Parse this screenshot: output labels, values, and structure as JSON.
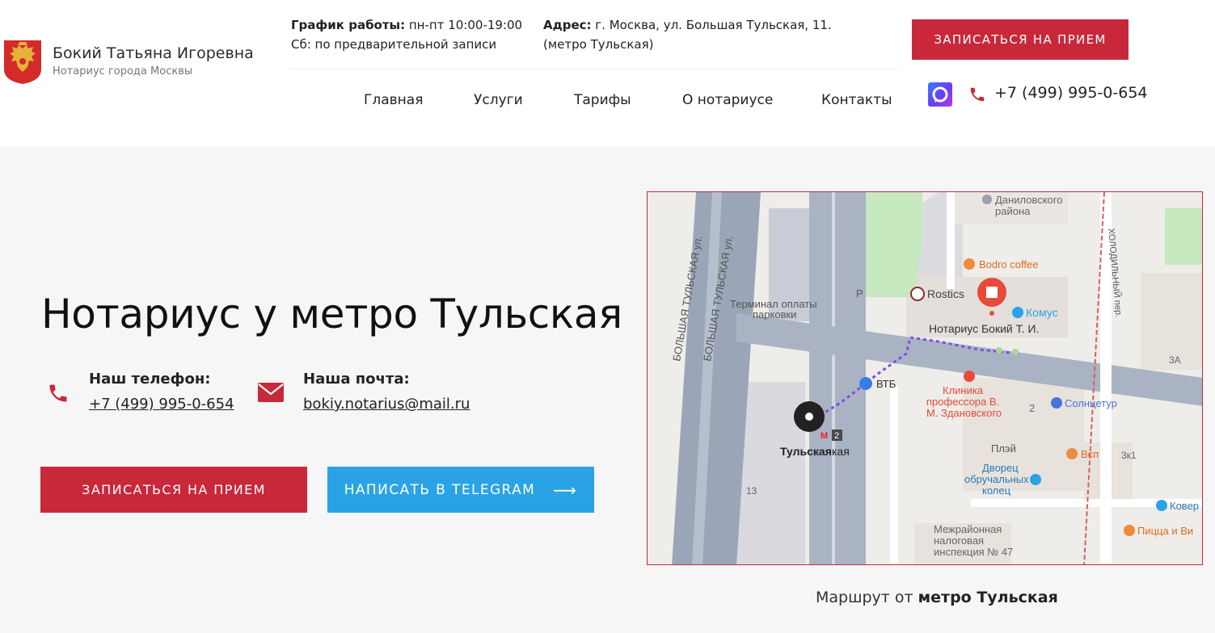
{
  "header": {
    "brand_name": "Бокий Татьяна Игоревна",
    "brand_sub": "Нотариус города Москвы",
    "hours_label": "График работы:",
    "hours_value": " пн-пт 10:00-19:00",
    "hours_sat": "Сб: по предварительной записи",
    "address_label": "Адрес:",
    "address_value": " г. Москва, ул. Большая Тульская, 11.",
    "address_metro": "(метро Тульская)",
    "cta": "ЗАПИСАТЬСЯ НА ПРИЕМ",
    "phone": "+7 (499) 995-0-654"
  },
  "nav": {
    "items": [
      {
        "label": "Главная"
      },
      {
        "label": "Услуги"
      },
      {
        "label": "Тарифы"
      },
      {
        "label": "О нотариусе"
      },
      {
        "label": "Контакты"
      }
    ]
  },
  "hero": {
    "title": "Нотариус у метро Тульская",
    "phone_label": "Наш телефон:",
    "phone_value": "+7 (499) 995-0-654",
    "email_label": "Наша почта:",
    "email_value": "bokiy.notarius@mail.ru",
    "btn_appointment": "ЗАПИСАТЬСЯ НА ПРИЕМ",
    "btn_telegram": "НАПИСАТЬ В TELEGRAM",
    "btn_telegram_arrow": "⟶"
  },
  "map": {
    "street_1": "БОЛЬШАЯ ТУЛЬСКАЯ ул.",
    "street_2": "БОЛЬШАЯ ТУЛЬСКАЯ ул.",
    "street_3": "ХОЛОДИЛЬНЫЙ пер.",
    "poi_danilov_1": "Даниловского",
    "poi_danilov_2": "района",
    "poi_bodro": "Bodro coffee",
    "poi_rostics": "Rostics",
    "poi_komus": "Комус",
    "poi_notary": "Нотариус Бокий Т. И.",
    "poi_terminal_1": "Терминал оплаты",
    "poi_terminal_2": "парковки",
    "poi_vtb": "ВТБ",
    "poi_clinic_1": "Клиника",
    "poi_clinic_2": "профессора В.",
    "poi_clinic_3": "М. Здановского",
    "poi_solnce": "Солнцетур",
    "poi_metro": "Тульская",
    "poi_metro_suffix": "кая",
    "poi_metro_badge": "2",
    "poi_pley": "Плэй",
    "poi_vsp": "Всп",
    "poi_dvorec_1": "Дворец",
    "poi_dvorec_2": "обручальных",
    "poi_dvorec_3": "колец",
    "poi_kover": "Ковер",
    "poi_pizza": "Пицца и Ви",
    "poi_tax_1": "Межрайонная",
    "poi_tax_2": "налоговая",
    "poi_tax_3": "инспекция № 47",
    "num_13": "13",
    "num_2": "2",
    "num_3k1": "3к1",
    "num_3a": "3А",
    "letter_r": "Р",
    "caption_prefix": "Маршрут от ",
    "caption_bold": "метро Тульская"
  },
  "colors": {
    "brand_red": "#c8283a",
    "telegram_blue": "#2aa3e6",
    "hero_bg": "#f6f6f6"
  },
  "icons": {
    "logo": "coat-of-arms-icon",
    "max": "max-messenger-icon",
    "phone": "phone-icon",
    "mail": "mail-icon"
  }
}
